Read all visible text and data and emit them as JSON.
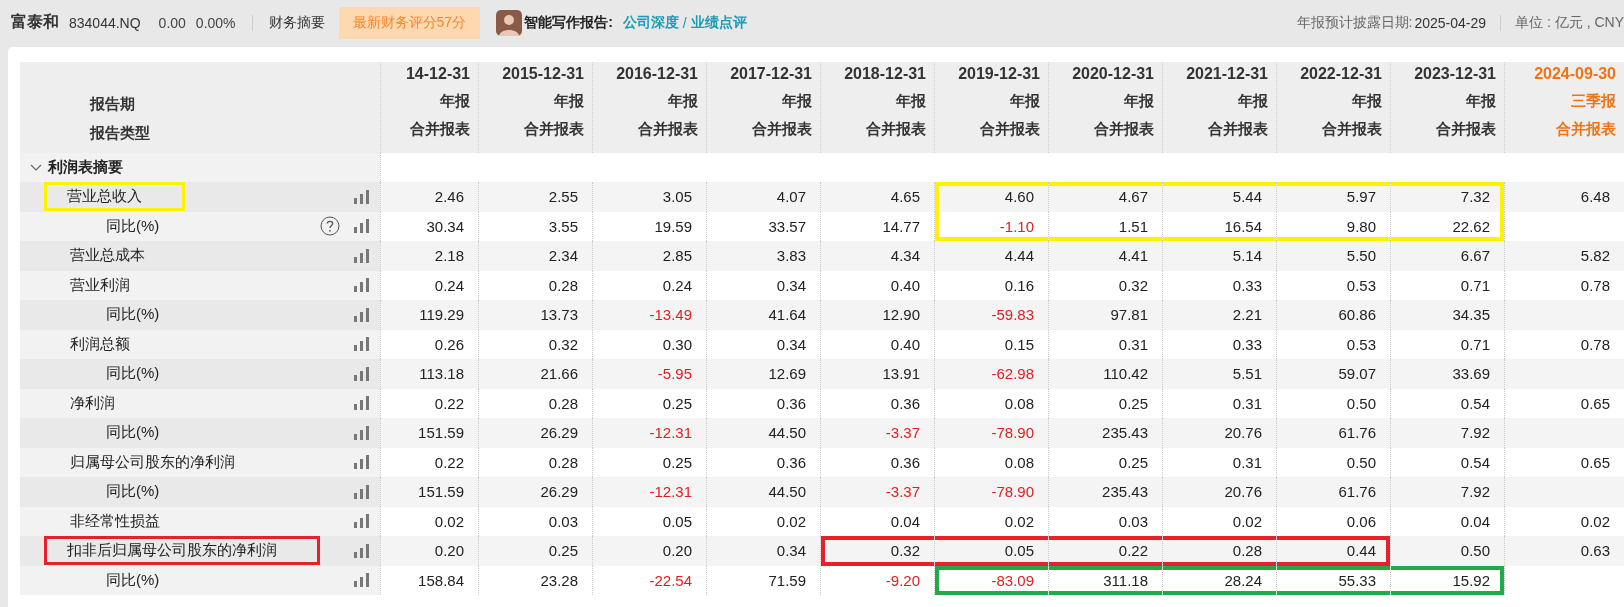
{
  "topbar": {
    "company": "富泰和",
    "code": "834044.NQ",
    "price": "0.00",
    "change": "0.00%",
    "nav": "财务摘要",
    "score_badge": "最新财务评分57分",
    "report_label": "智能写作报告:",
    "report_links": [
      "公司深度",
      "业绩点评"
    ],
    "link_separator": "/",
    "disclosure_label": "年报预计披露日期:",
    "disclosure_date": "2025-04-29",
    "unit": "单位 : 亿元 , CNY"
  },
  "table": {
    "header_labels": [
      "报告期",
      "报告类型"
    ],
    "columns": [
      {
        "date": "14-12-31",
        "period": "年报",
        "type": "合并报表",
        "latest": false
      },
      {
        "date": "2015-12-31",
        "period": "年报",
        "type": "合并报表",
        "latest": false
      },
      {
        "date": "2016-12-31",
        "period": "年报",
        "type": "合并报表",
        "latest": false
      },
      {
        "date": "2017-12-31",
        "period": "年报",
        "type": "合并报表",
        "latest": false
      },
      {
        "date": "2018-12-31",
        "period": "年报",
        "type": "合并报表",
        "latest": false
      },
      {
        "date": "2019-12-31",
        "period": "年报",
        "type": "合并报表",
        "latest": false
      },
      {
        "date": "2020-12-31",
        "period": "年报",
        "type": "合并报表",
        "latest": false
      },
      {
        "date": "2021-12-31",
        "period": "年报",
        "type": "合并报表",
        "latest": false
      },
      {
        "date": "2022-12-31",
        "period": "年报",
        "type": "合并报表",
        "latest": false
      },
      {
        "date": "2023-12-31",
        "period": "年报",
        "type": "合并报表",
        "latest": false
      },
      {
        "date": "2024-09-30",
        "period": "三季报",
        "type": "合并报表",
        "latest": true
      }
    ],
    "sections": [
      {
        "title": "利润表摘要",
        "expanded": true,
        "items": [
          {
            "label": "营业总收入",
            "help": false,
            "color": "#fff200",
            "cells": [
              {
                "text": "2.46",
                "negative": false
              },
              {
                "text": "2.55",
                "negative": false
              },
              {
                "text": "3.05",
                "negative": false
              },
              {
                "text": "4.07",
                "negative": false
              },
              {
                "text": "4.65",
                "negative": false
              },
              {
                "text": "4.60",
                "negative": false,
                "color": "#fff200"
              },
              {
                "text": "4.67",
                "negative": false,
                "color": "#fff200"
              },
              {
                "text": "5.44",
                "negative": false,
                "color": "#fff200"
              },
              {
                "text": "5.97",
                "negative": false,
                "color": "#fff200"
              },
              {
                "text": "7.32",
                "negative": false,
                "color": "#fff200"
              },
              {
                "text": "6.48",
                "negative": false
              }
            ],
            "children": [
              {
                "label": "同比(%)",
                "help": true,
                "cells": [
                  {
                    "text": "30.34",
                    "negative": false
                  },
                  {
                    "text": "3.55",
                    "negative": false
                  },
                  {
                    "text": "19.59",
                    "negative": false
                  },
                  {
                    "text": "33.57",
                    "negative": false
                  },
                  {
                    "text": "14.77",
                    "negative": false
                  },
                  {
                    "text": "-1.10",
                    "negative": true,
                    "color": "#fff200"
                  },
                  {
                    "text": "1.51",
                    "negative": false,
                    "color": "#fff200"
                  },
                  {
                    "text": "16.54",
                    "negative": false,
                    "color": "#fff200"
                  },
                  {
                    "text": "9.80",
                    "negative": false,
                    "color": "#fff200"
                  },
                  {
                    "text": "22.62",
                    "negative": false,
                    "color": "#fff200"
                  }
                ]
              }
            ]
          },
          {
            "label": "营业总成本",
            "help": false,
            "cells": [
              {
                "text": "2.18",
                "negative": false
              },
              {
                "text": "2.34",
                "negative": false
              },
              {
                "text": "2.85",
                "negative": false
              },
              {
                "text": "3.83",
                "negative": false
              },
              {
                "text": "4.34",
                "negative": false
              },
              {
                "text": "4.44",
                "negative": false
              },
              {
                "text": "4.41",
                "negative": false
              },
              {
                "text": "5.14",
                "negative": false
              },
              {
                "text": "5.50",
                "negative": false
              },
              {
                "text": "6.67",
                "negative": false
              },
              {
                "text": "5.82",
                "negative": false
              }
            ]
          },
          {
            "label": "营业利润",
            "help": false,
            "cells": [
              {
                "text": "0.24",
                "negative": false
              },
              {
                "text": "0.28",
                "negative": false
              },
              {
                "text": "0.24",
                "negative": false
              },
              {
                "text": "0.34",
                "negative": false
              },
              {
                "text": "0.40",
                "negative": false
              },
              {
                "text": "0.16",
                "negative": false
              },
              {
                "text": "0.32",
                "negative": false
              },
              {
                "text": "0.33",
                "negative": false
              },
              {
                "text": "0.53",
                "negative": false
              },
              {
                "text": "0.71",
                "negative": false
              },
              {
                "text": "0.78",
                "negative": false
              }
            ],
            "children": [
              {
                "label": "同比(%)",
                "help": false,
                "cells": [
                  {
                    "text": "119.29",
                    "negative": false
                  },
                  {
                    "text": "13.73",
                    "negative": false
                  },
                  {
                    "text": "-13.49",
                    "negative": true
                  },
                  {
                    "text": "41.64",
                    "negative": false
                  },
                  {
                    "text": "12.90",
                    "negative": false
                  },
                  {
                    "text": "-59.83",
                    "negative": true
                  },
                  {
                    "text": "97.81",
                    "negative": false
                  },
                  {
                    "text": "2.21",
                    "negative": false
                  },
                  {
                    "text": "60.86",
                    "negative": false
                  },
                  {
                    "text": "34.35",
                    "negative": false
                  }
                ]
              }
            ]
          },
          {
            "label": "利润总额",
            "help": false,
            "cells": [
              {
                "text": "0.26",
                "negative": false
              },
              {
                "text": "0.32",
                "negative": false
              },
              {
                "text": "0.30",
                "negative": false
              },
              {
                "text": "0.34",
                "negative": false
              },
              {
                "text": "0.40",
                "negative": false
              },
              {
                "text": "0.15",
                "negative": false
              },
              {
                "text": "0.31",
                "negative": false
              },
              {
                "text": "0.33",
                "negative": false
              },
              {
                "text": "0.53",
                "negative": false
              },
              {
                "text": "0.71",
                "negative": false
              },
              {
                "text": "0.78",
                "negative": false
              }
            ],
            "children": [
              {
                "label": "同比(%)",
                "help": false,
                "cells": [
                  {
                    "text": "113.18",
                    "negative": false
                  },
                  {
                    "text": "21.66",
                    "negative": false
                  },
                  {
                    "text": "-5.95",
                    "negative": true
                  },
                  {
                    "text": "12.69",
                    "negative": false
                  },
                  {
                    "text": "13.91",
                    "negative": false
                  },
                  {
                    "text": "-62.98",
                    "negative": true
                  },
                  {
                    "text": "110.42",
                    "negative": false
                  },
                  {
                    "text": "5.51",
                    "negative": false
                  },
                  {
                    "text": "59.07",
                    "negative": false
                  },
                  {
                    "text": "33.69",
                    "negative": false
                  }
                ]
              }
            ]
          },
          {
            "label": "净利润",
            "help": false,
            "cells": [
              {
                "text": "0.22",
                "negative": false
              },
              {
                "text": "0.28",
                "negative": false
              },
              {
                "text": "0.25",
                "negative": false
              },
              {
                "text": "0.36",
                "negative": false
              },
              {
                "text": "0.36",
                "negative": false
              },
              {
                "text": "0.08",
                "negative": false
              },
              {
                "text": "0.25",
                "negative": false
              },
              {
                "text": "0.31",
                "negative": false
              },
              {
                "text": "0.50",
                "negative": false
              },
              {
                "text": "0.54",
                "negative": false
              },
              {
                "text": "0.65",
                "negative": false
              }
            ],
            "children": [
              {
                "label": "同比(%)",
                "help": false,
                "cells": [
                  {
                    "text": "151.59",
                    "negative": false
                  },
                  {
                    "text": "26.29",
                    "negative": false
                  },
                  {
                    "text": "-12.31",
                    "negative": true
                  },
                  {
                    "text": "44.50",
                    "negative": false
                  },
                  {
                    "text": "-3.37",
                    "negative": true
                  },
                  {
                    "text": "-78.90",
                    "negative": true
                  },
                  {
                    "text": "235.43",
                    "negative": false
                  },
                  {
                    "text": "20.76",
                    "negative": false
                  },
                  {
                    "text": "61.76",
                    "negative": false
                  },
                  {
                    "text": "7.92",
                    "negative": false
                  }
                ]
              }
            ]
          },
          {
            "label": "归属母公司股东的净利润",
            "help": false,
            "cells": [
              {
                "text": "0.22",
                "negative": false
              },
              {
                "text": "0.28",
                "negative": false
              },
              {
                "text": "0.25",
                "negative": false
              },
              {
                "text": "0.36",
                "negative": false
              },
              {
                "text": "0.36",
                "negative": false
              },
              {
                "text": "0.08",
                "negative": false
              },
              {
                "text": "0.25",
                "negative": false
              },
              {
                "text": "0.31",
                "negative": false
              },
              {
                "text": "0.50",
                "negative": false
              },
              {
                "text": "0.54",
                "negative": false
              },
              {
                "text": "0.65",
                "negative": false
              }
            ],
            "children": [
              {
                "label": "同比(%)",
                "help": false,
                "cells": [
                  {
                    "text": "151.59",
                    "negative": false
                  },
                  {
                    "text": "26.29",
                    "negative": false
                  },
                  {
                    "text": "-12.31",
                    "negative": true
                  },
                  {
                    "text": "44.50",
                    "negative": false
                  },
                  {
                    "text": "-3.37",
                    "negative": true
                  },
                  {
                    "text": "-78.90",
                    "negative": true
                  },
                  {
                    "text": "235.43",
                    "negative": false
                  },
                  {
                    "text": "20.76",
                    "negative": false
                  },
                  {
                    "text": "61.76",
                    "negative": false
                  },
                  {
                    "text": "7.92",
                    "negative": false
                  }
                ]
              }
            ]
          },
          {
            "label": "非经常性损益",
            "help": false,
            "cells": [
              {
                "text": "0.02",
                "negative": false
              },
              {
                "text": "0.03",
                "negative": false
              },
              {
                "text": "0.05",
                "negative": false
              },
              {
                "text": "0.02",
                "negative": false
              },
              {
                "text": "0.04",
                "negative": false
              },
              {
                "text": "0.02",
                "negative": false
              },
              {
                "text": "0.03",
                "negative": false
              },
              {
                "text": "0.02",
                "negative": false
              },
              {
                "text": "0.06",
                "negative": false
              },
              {
                "text": "0.04",
                "negative": false
              },
              {
                "text": "0.02",
                "negative": false
              }
            ]
          },
          {
            "label": "扣非后归属母公司股东的净利润",
            "help": false,
            "color": "#e8202a",
            "cells": [
              {
                "text": "0.20",
                "negative": false
              },
              {
                "text": "0.25",
                "negative": false
              },
              {
                "text": "0.20",
                "negative": false
              },
              {
                "text": "0.34",
                "negative": false
              },
              {
                "text": "0.32",
                "negative": false,
                "color": "#e8202a"
              },
              {
                "text": "0.05",
                "negative": false,
                "color": "#e8202a"
              },
              {
                "text": "0.22",
                "negative": false,
                "color": "#e8202a"
              },
              {
                "text": "0.28",
                "negative": false,
                "color": "#e8202a"
              },
              {
                "text": "0.44",
                "negative": false,
                "color": "#e8202a"
              },
              {
                "text": "0.50",
                "negative": false
              },
              {
                "text": "0.63",
                "negative": false
              }
            ],
            "children": [
              {
                "label": "同比(%)",
                "help": false,
                "cells": [
                  {
                    "text": "158.84",
                    "negative": false
                  },
                  {
                    "text": "23.28",
                    "negative": false
                  },
                  {
                    "text": "-22.54",
                    "negative": true
                  },
                  {
                    "text": "71.59",
                    "negative": false
                  },
                  {
                    "text": "-9.20",
                    "negative": true
                  },
                  {
                    "text": "-83.09",
                    "negative": true,
                    "color": "#22aa48"
                  },
                  {
                    "text": "311.18",
                    "negative": false,
                    "color": "#22aa48"
                  },
                  {
                    "text": "28.24",
                    "negative": false,
                    "color": "#22aa48"
                  },
                  {
                    "text": "55.33",
                    "negative": false,
                    "color": "#22aa48"
                  },
                  {
                    "text": "15.92",
                    "negative": false,
                    "color": "#22aa48"
                  }
                ]
              }
            ]
          }
        ]
      }
    ]
  }
}
